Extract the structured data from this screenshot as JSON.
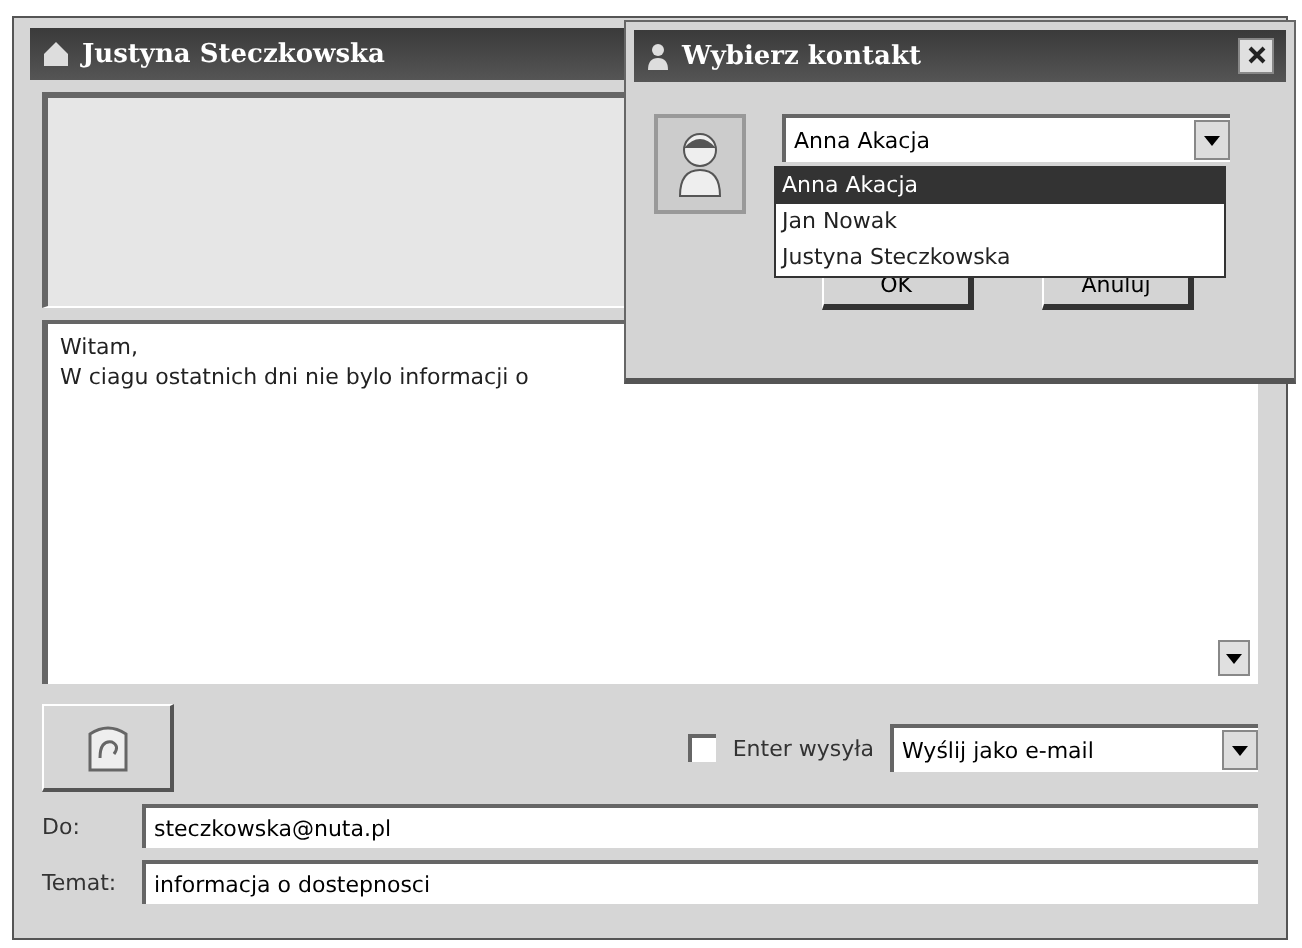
{
  "window": {
    "title": "Justyna Steczkowska"
  },
  "message": {
    "lines": [
      "Witam,",
      "W ciagu ostatnich dni nie bylo informacji o"
    ]
  },
  "enter_sends": {
    "label": "Enter wysyła",
    "checked": false
  },
  "send_mode": {
    "value": "Wyślij jako e-mail"
  },
  "fields": [
    {
      "label": "Do:",
      "value": "steczkowska@nuta.pl"
    },
    {
      "label": "Temat:",
      "value": "informacja o dostepnosci"
    }
  ],
  "dialog": {
    "title": "Wybierz kontakt",
    "contact": {
      "value": "Anna Akacja"
    },
    "options": [
      {
        "label": "Anna Akacja",
        "selected": true
      },
      {
        "label": "Jan Nowak",
        "selected": false
      },
      {
        "label": "Justyna Steczkowska",
        "selected": false
      }
    ],
    "buttons": [
      "OK",
      "Anuluj"
    ]
  }
}
